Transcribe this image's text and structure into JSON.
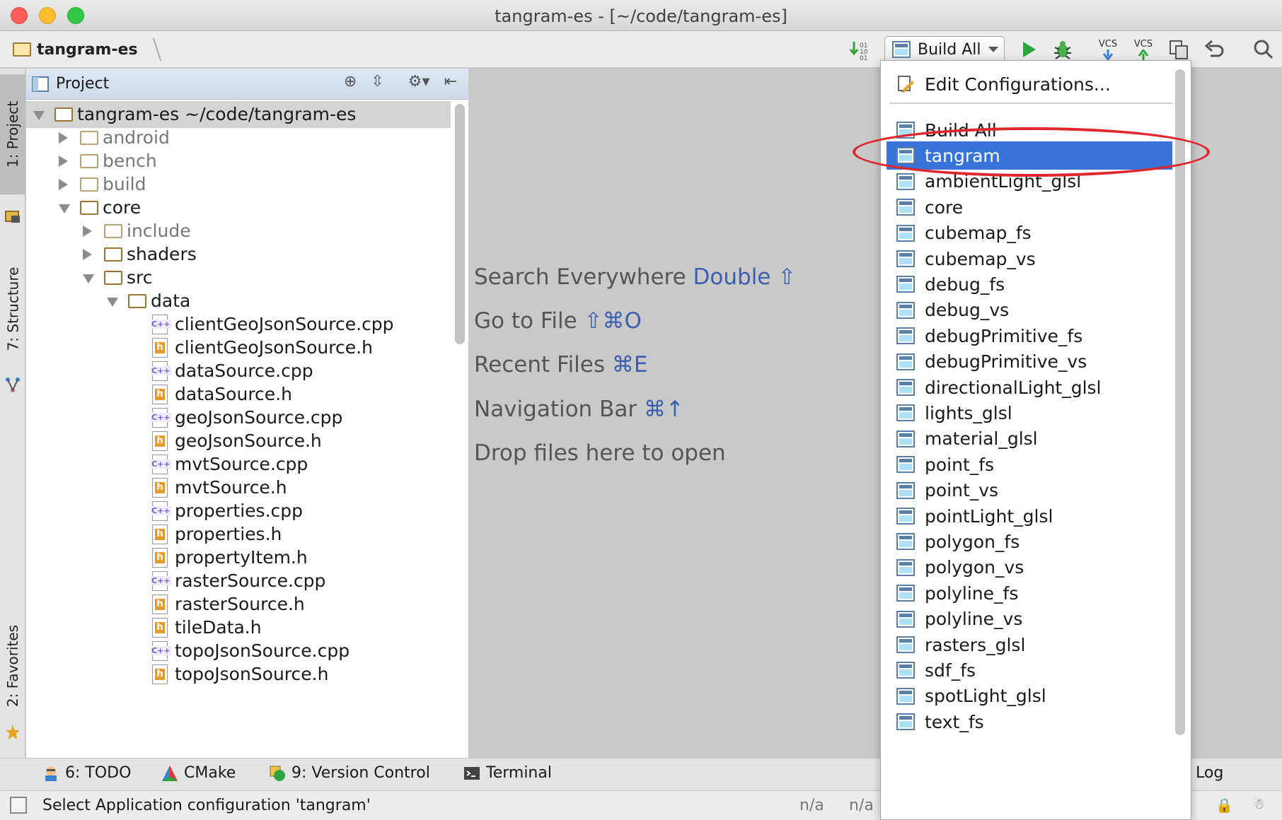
{
  "window": {
    "title": "tangram-es - [~/code/tangram-es]"
  },
  "navbar": {
    "breadcrumb": "tangram-es",
    "config_selected": "Build All",
    "vcs_update_label": "VCS",
    "vcs_commit_label": "VCS"
  },
  "leftstrip": {
    "project_tab": "1: Project",
    "structure_tab": "7: Structure",
    "favorites_tab": "2: Favorites"
  },
  "project": {
    "panel_title": "Project",
    "tree": [
      {
        "label": "tangram-es   ~/code/tangram-es",
        "type": "folder",
        "depth": 0,
        "expanded": true,
        "selected": true
      },
      {
        "label": "android",
        "type": "folder",
        "depth": 1,
        "expanded": false,
        "dim": true
      },
      {
        "label": "bench",
        "type": "folder",
        "depth": 1,
        "expanded": false,
        "dim": true
      },
      {
        "label": "build",
        "type": "folder",
        "depth": 1,
        "expanded": false,
        "dim": true
      },
      {
        "label": "core",
        "type": "folder",
        "depth": 1,
        "expanded": true
      },
      {
        "label": "include",
        "type": "folder",
        "depth": 2,
        "expanded": false,
        "dim": true
      },
      {
        "label": "shaders",
        "type": "folder",
        "depth": 2,
        "expanded": false
      },
      {
        "label": "src",
        "type": "folder",
        "depth": 2,
        "expanded": true
      },
      {
        "label": "data",
        "type": "folder",
        "depth": 3,
        "expanded": true
      },
      {
        "label": "clientGeoJsonSource.cpp",
        "type": "cpp",
        "depth": 4
      },
      {
        "label": "clientGeoJsonSource.h",
        "type": "h",
        "depth": 4
      },
      {
        "label": "dataSource.cpp",
        "type": "cpp",
        "depth": 4
      },
      {
        "label": "dataSource.h",
        "type": "h",
        "depth": 4
      },
      {
        "label": "geoJsonSource.cpp",
        "type": "cpp",
        "depth": 4
      },
      {
        "label": "geoJsonSource.h",
        "type": "h",
        "depth": 4
      },
      {
        "label": "mvtSource.cpp",
        "type": "cpp",
        "depth": 4
      },
      {
        "label": "mvtSource.h",
        "type": "h",
        "depth": 4
      },
      {
        "label": "properties.cpp",
        "type": "cpp",
        "depth": 4
      },
      {
        "label": "properties.h",
        "type": "h",
        "depth": 4
      },
      {
        "label": "propertyItem.h",
        "type": "h",
        "depth": 4
      },
      {
        "label": "rasterSource.cpp",
        "type": "cpp",
        "depth": 4
      },
      {
        "label": "rasterSource.h",
        "type": "h",
        "depth": 4
      },
      {
        "label": "tileData.h",
        "type": "h",
        "depth": 4
      },
      {
        "label": "topoJsonSource.cpp",
        "type": "cpp",
        "depth": 4
      },
      {
        "label": "topoJsonSource.h",
        "type": "h",
        "depth": 4
      }
    ]
  },
  "editor_hints": [
    {
      "text": "Search Everywhere",
      "key": "Double ⇧"
    },
    {
      "text": "Go to File",
      "key": "⇧⌘O"
    },
    {
      "text": "Recent Files",
      "key": "⌘E"
    },
    {
      "text": "Navigation Bar",
      "key": "⌘↑"
    },
    {
      "text": "Drop files here to open",
      "key": ""
    }
  ],
  "config_popup": {
    "edit_label": "Edit Configurations...",
    "items": [
      "Build All",
      "tangram",
      "ambientLight_glsl",
      "core",
      "cubemap_fs",
      "cubemap_vs",
      "debug_fs",
      "debug_vs",
      "debugPrimitive_fs",
      "debugPrimitive_vs",
      "directionalLight_glsl",
      "lights_glsl",
      "material_glsl",
      "point_fs",
      "point_vs",
      "pointLight_glsl",
      "polygon_fs",
      "polygon_vs",
      "polyline_fs",
      "polyline_vs",
      "rasters_glsl",
      "sdf_fs",
      "spotLight_glsl",
      "text_fs"
    ],
    "selected": "tangram"
  },
  "bottom_tabs": {
    "todo": "6: TODO",
    "cmake": "CMake",
    "vcs": "9: Version Control",
    "terminal": "Terminal",
    "event_log": "Event Log"
  },
  "status": {
    "message": "Select Application configuration 'tangram'",
    "pos1": "n/a",
    "pos2": "n/a"
  },
  "colors": {
    "selection": "#3874d8",
    "highlight_ring": "#e0262d",
    "hint_key": "#3c5fad"
  }
}
